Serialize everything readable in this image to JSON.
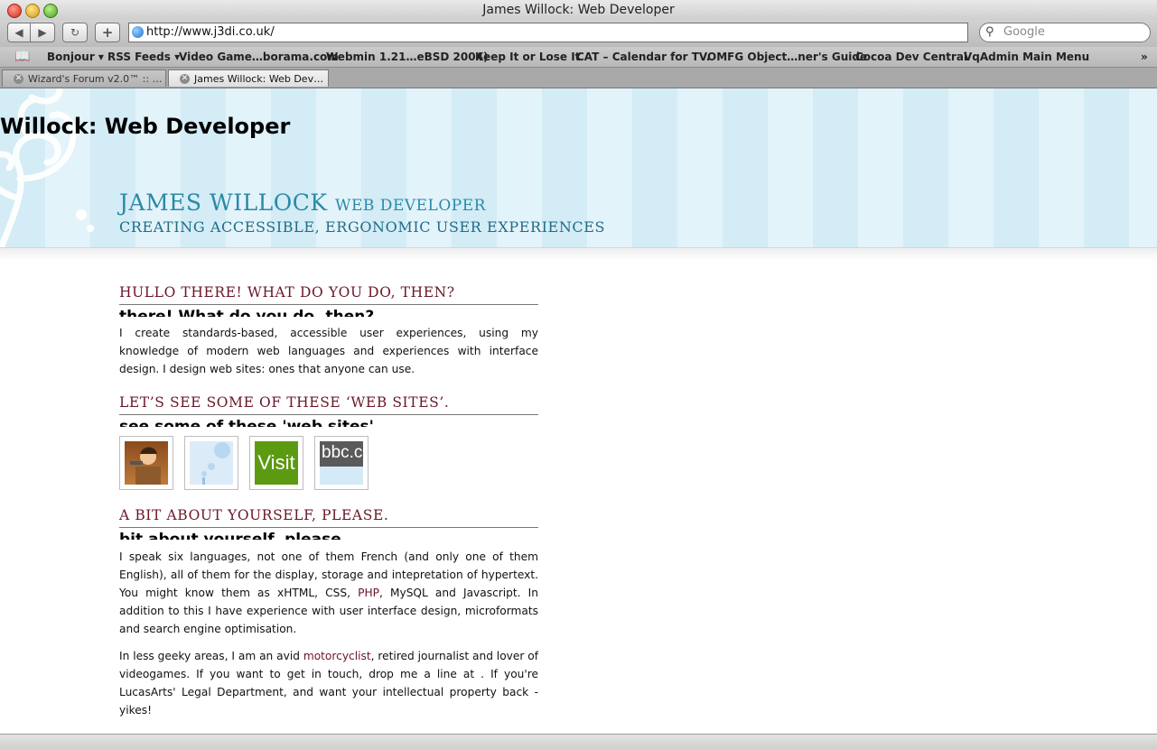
{
  "window": {
    "title": "James Willock: Web Developer"
  },
  "toolbar": {
    "url": "http://www.j3di.co.uk/",
    "search_placeholder": "Google",
    "reload_glyph": "↻",
    "add_glyph": "+",
    "back_glyph": "◀",
    "forward_glyph": "▶"
  },
  "bookmarks": {
    "items": [
      {
        "label": "Bonjour ▾"
      },
      {
        "label": "RSS Feeds ▾"
      },
      {
        "label": "Video Game…borama.com"
      },
      {
        "label": "Webmin 1.21…eBSD 2004)"
      },
      {
        "label": "Keep It or Lose It"
      },
      {
        "label": "CAT – Calendar for TV."
      },
      {
        "label": "OMFG Object…ner's Guide"
      },
      {
        "label": "Cocoa Dev Central"
      },
      {
        "label": "VqAdmin Main Menu"
      }
    ],
    "overflow": "»"
  },
  "tabs": [
    {
      "label": "Wizard's Forum v2.0™ :: …"
    },
    {
      "label": "James Willock: Web Dev…"
    }
  ],
  "page": {
    "h1": "Willock: Web Developer",
    "logo_name": "JAMES WILLOCK",
    "logo_role": "WEB DEVELOPER",
    "logo_tagline": "CREATING ACCESSIBLE, ERGONOMIC USER EXPERIENCES",
    "sections": [
      {
        "title": "HULLO THERE!  WHAT DO YOU DO, THEN?",
        "ghost": "there! What do you do, then?",
        "body": "I create standards-based, accessible user experiences, using my knowledge of modern web languages and experiences with interface design. I design web sites: ones that anyone can use."
      },
      {
        "title": "LET’S SEE SOME OF THESE ‘WEB SITES’.",
        "ghost": "see some of these 'web sites'."
      },
      {
        "title": "A BIT ABOUT YOURSELF, PLEASE.",
        "ghost": "bit about yourself, please."
      }
    ],
    "thumbs": [
      {
        "name": "character"
      },
      {
        "name": "bubbles"
      },
      {
        "name": "visit",
        "text": "Visit"
      },
      {
        "name": "bbc",
        "text": "bbc.c"
      }
    ],
    "about_p1": {
      "a": "I speak six languages, not one of them French (and only one of them English), all of them for the display, storage and intepretation of hypertext. You might know them as xHTML, CSS, ",
      "link": "PHP",
      "b": ", MySQL and Javascript. In addition to this I have experience with user interface design, microformats and search engine optimisation."
    },
    "about_p2": {
      "a": "In less geeky areas, I am an avid ",
      "link": "motorcyclist",
      "b": ", retired journalist and lover of videogames. If you want to get in touch, drop me a line at . If you're LucasArts' Legal Department, and want your intellectual property back - yikes!"
    }
  }
}
